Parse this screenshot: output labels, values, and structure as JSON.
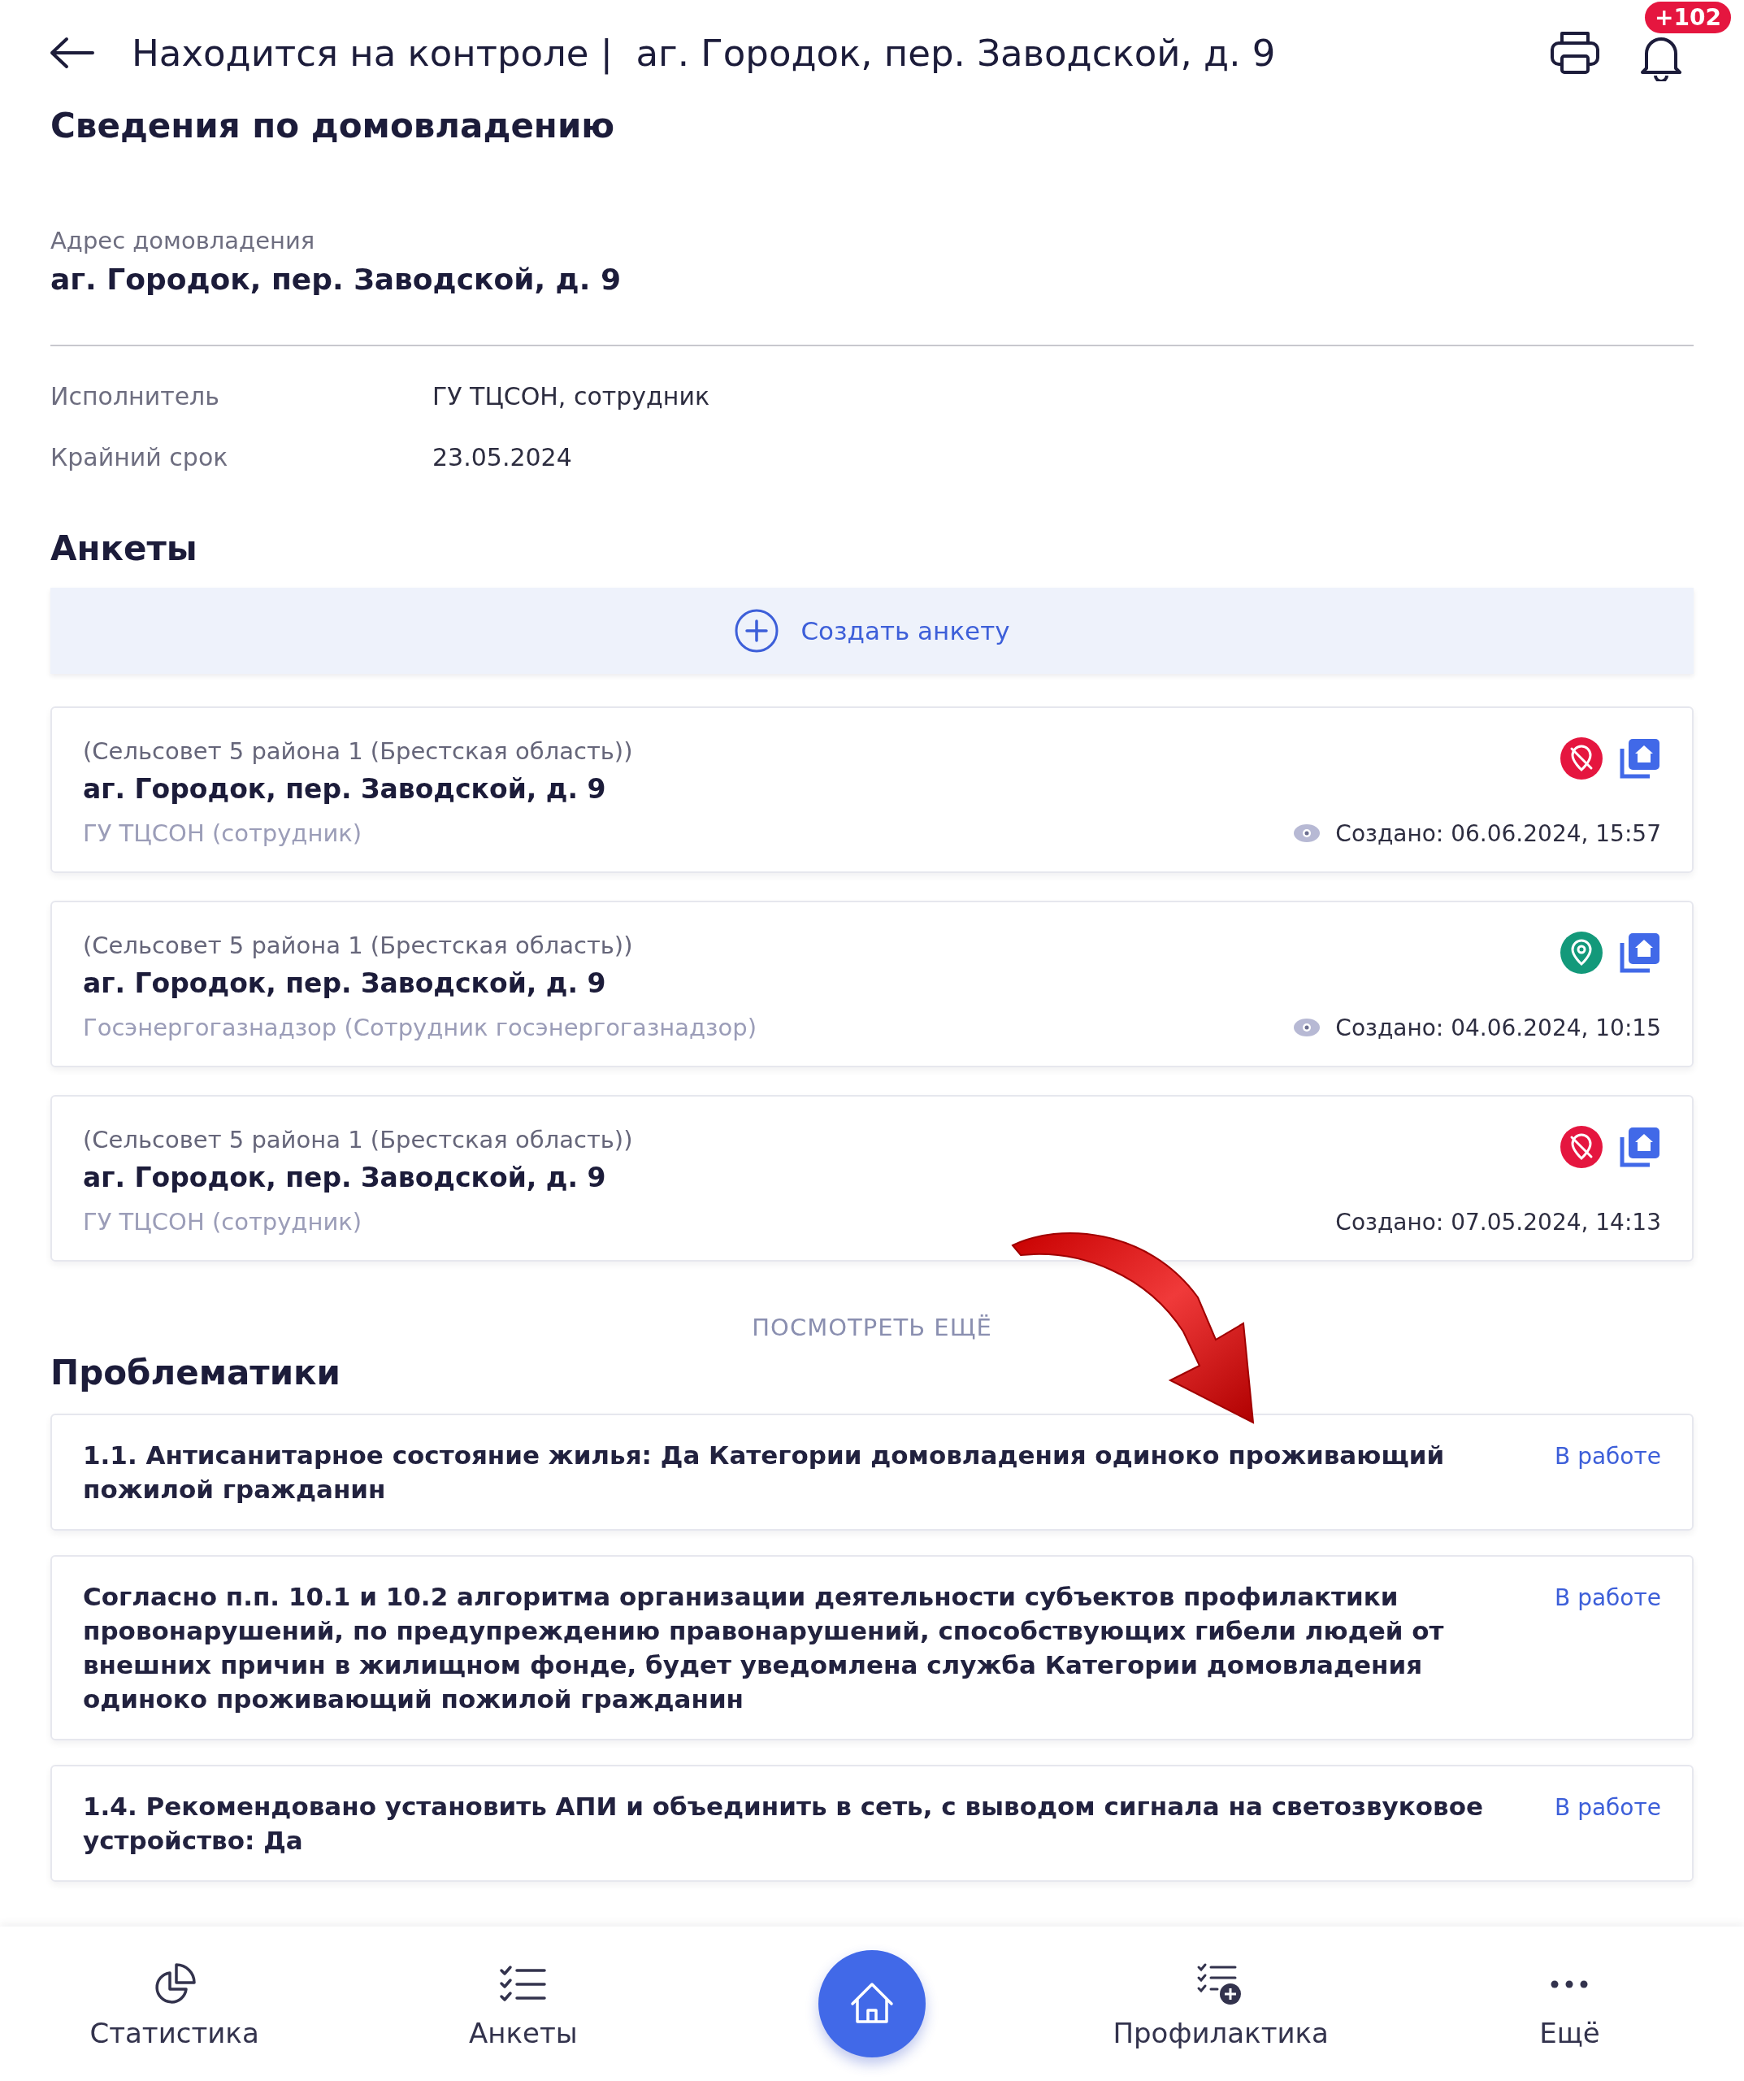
{
  "header": {
    "title": "Находится на контроле |  аг. Городок, пер. Заводской, д. 9",
    "notification_badge": "+102"
  },
  "household": {
    "heading": "Сведения по домовладению",
    "address_label": "Адрес домовладения",
    "address": "аг. Городок, пер. Заводской, д. 9",
    "details": [
      {
        "label": "Исполнитель",
        "value": "ГУ ТЦСОН, сотрудник"
      },
      {
        "label": "Крайний срок",
        "value": "23.05.2024"
      }
    ]
  },
  "surveys": {
    "heading": "Анкеты",
    "create_button": "Создать анкету",
    "items": [
      {
        "region": "(Сельсовет 5 района 1 (Брестская область))",
        "address": "аг. Городок, пер. Заводской, д. 9",
        "author": "ГУ ТЦСОН (сотрудник)",
        "created": "Создано: 06.06.2024, 15:57",
        "location_confirmed": false,
        "viewed": true
      },
      {
        "region": "(Сельсовет 5 района 1 (Брестская область))",
        "address": "аг. Городок, пер. Заводской, д. 9",
        "author": "Госэнергогазнадзор (Сотрудник госэнергогазнадзор)",
        "created": "Создано: 04.06.2024, 10:15",
        "location_confirmed": true,
        "viewed": true
      },
      {
        "region": "(Сельсовет 5 района 1 (Брестская область))",
        "address": "аг. Городок, пер. Заводской, д. 9",
        "author": "ГУ ТЦСОН (сотрудник)",
        "created": "Создано: 07.05.2024, 14:13",
        "location_confirmed": false,
        "viewed": false
      }
    ],
    "more_link": "ПОСМОТРЕТЬ ЕЩЁ"
  },
  "problems": {
    "heading": "Проблематики",
    "items": [
      {
        "text": "1.1. Антисанитарное состояние жилья: Да Категории домовладения одиноко проживающий пожилой гражданин",
        "status": "В работе"
      },
      {
        "text": "Согласно п.п. 10.1 и 10.2 алгоритма организации деятельности субъектов профилактики провонарушений, по предупреждению правонарушений, способствующих гибели людей от внешних причин в жилищном фонде, будет уведомлена служба Категории домовладения одиноко проживающий пожилой гражданин",
        "status": "В работе"
      },
      {
        "text": "1.4. Рекомендовано установить АПИ и объединить в сеть, с выводом сигнала на светозвуковое устройство: Да",
        "status": "В работе"
      }
    ]
  },
  "bottom_nav": [
    {
      "kind": "stats",
      "label": "Статистика"
    },
    {
      "kind": "surveys",
      "label": "Анкеты"
    },
    {
      "kind": "home"
    },
    {
      "kind": "prevention",
      "label": "Профилактика"
    },
    {
      "kind": "more",
      "label": "Ещё"
    }
  ]
}
